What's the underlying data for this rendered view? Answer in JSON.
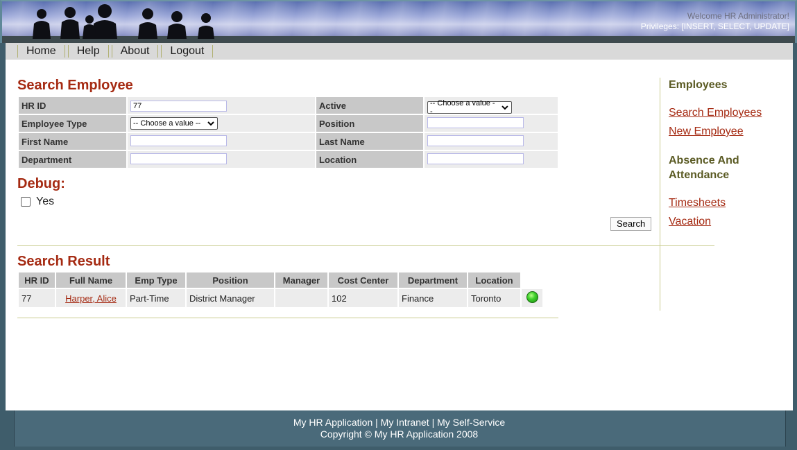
{
  "header": {
    "welcome": "Welcome HR Administrator!",
    "privileges": "Privileges: [INSERT, SELECT, UPDATE]"
  },
  "nav": {
    "items": [
      {
        "label": "Home"
      },
      {
        "label": "Help"
      },
      {
        "label": "About"
      },
      {
        "label": "Logout"
      }
    ]
  },
  "search_form": {
    "title": "Search Employee",
    "hr_id": {
      "label": "HR ID",
      "value": "77"
    },
    "active": {
      "label": "Active",
      "selected": "-- Choose a value --"
    },
    "employee_type": {
      "label": "Employee Type",
      "selected": "-- Choose a value --"
    },
    "position": {
      "label": "Position",
      "value": ""
    },
    "first_name": {
      "label": "First Name",
      "value": ""
    },
    "last_name": {
      "label": "Last Name",
      "value": ""
    },
    "department": {
      "label": "Department",
      "value": ""
    },
    "location": {
      "label": "Location",
      "value": ""
    },
    "search_label": "Search"
  },
  "debug": {
    "title": "Debug:",
    "option": "Yes",
    "checked": false
  },
  "results": {
    "title": "Search Result",
    "columns": [
      "HR ID",
      "Full Name",
      "Emp Type",
      "Position",
      "Manager",
      "Cost Center",
      "Department",
      "Location"
    ],
    "rows": [
      {
        "hr_id": "77",
        "full_name": "Harper, Alice",
        "emp_type": "Part-Time",
        "position": "District Manager",
        "manager": "",
        "cost_center": "102",
        "department": "Finance",
        "location": "Toronto",
        "status_color": "#3fd12b"
      }
    ]
  },
  "sidebar": {
    "employees_heading": "Employees",
    "search_employees": "Search Employees",
    "new_employee": "New Employee",
    "attendance_heading_line1": "Absence And",
    "attendance_heading_line2": "Attendance",
    "timesheets": "Timesheets",
    "vacation": "Vacation"
  },
  "footer": {
    "links_line": "My HR Application | My Intranet | My Self-Service",
    "copyright": "Copyright © My HR Application 2008"
  },
  "colors": {
    "accent": "#a52a12",
    "sidebar_heading": "#5a5a23",
    "label_bg": "#c8c8c8",
    "value_bg": "#ececec"
  }
}
